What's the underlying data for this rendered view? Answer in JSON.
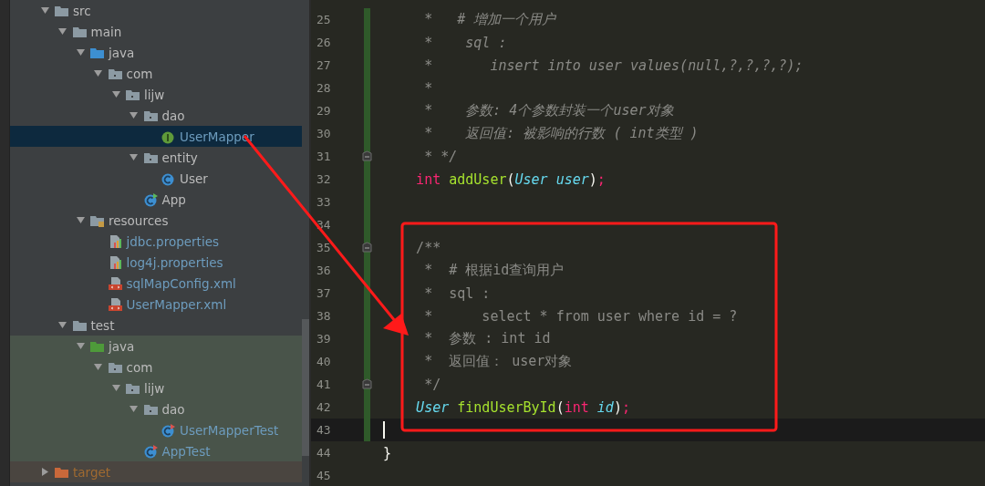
{
  "project_tree": {
    "items": [
      {
        "label": "src",
        "kind": "folder",
        "expanded": true,
        "selected": false,
        "test_scope": false,
        "children": [
          {
            "label": "main",
            "kind": "folder",
            "expanded": true,
            "selected": false,
            "test_scope": false,
            "children": [
              {
                "label": "java",
                "kind": "source-folder",
                "expanded": true,
                "selected": false,
                "test_scope": false,
                "children": [
                  {
                    "label": "com",
                    "kind": "package",
                    "expanded": true,
                    "selected": false,
                    "test_scope": false,
                    "children": [
                      {
                        "label": "lijw",
                        "kind": "package",
                        "expanded": true,
                        "selected": false,
                        "test_scope": false,
                        "children": [
                          {
                            "label": "dao",
                            "kind": "package",
                            "expanded": true,
                            "selected": false,
                            "test_scope": false,
                            "children": [
                              {
                                "label": "UserMapper",
                                "kind": "interface",
                                "selected": true,
                                "test_scope": false
                              }
                            ]
                          },
                          {
                            "label": "entity",
                            "kind": "package",
                            "expanded": true,
                            "selected": false,
                            "test_scope": false,
                            "children": [
                              {
                                "label": "User",
                                "kind": "class",
                                "selected": false,
                                "test_scope": false
                              }
                            ]
                          },
                          {
                            "label": "App",
                            "kind": "main-class",
                            "selected": false,
                            "test_scope": false
                          }
                        ]
                      }
                    ]
                  }
                ]
              },
              {
                "label": "resources",
                "kind": "resources-folder",
                "expanded": true,
                "selected": false,
                "test_scope": false,
                "children": [
                  {
                    "label": "jdbc.properties",
                    "kind": "properties",
                    "selected": false,
                    "test_scope": false
                  },
                  {
                    "label": "log4j.properties",
                    "kind": "properties",
                    "selected": false,
                    "test_scope": false
                  },
                  {
                    "label": "sqlMapConfig.xml",
                    "kind": "xml",
                    "selected": false,
                    "test_scope": false
                  },
                  {
                    "label": "UserMapper.xml",
                    "kind": "xml",
                    "selected": false,
                    "test_scope": false
                  }
                ]
              }
            ]
          },
          {
            "label": "test",
            "kind": "folder",
            "expanded": true,
            "selected": false,
            "test_scope": false,
            "children": [
              {
                "label": "java",
                "kind": "test-folder",
                "expanded": true,
                "selected": false,
                "test_scope": true,
                "children": [
                  {
                    "label": "com",
                    "kind": "package",
                    "expanded": true,
                    "selected": false,
                    "test_scope": true,
                    "children": [
                      {
                        "label": "lijw",
                        "kind": "package",
                        "expanded": true,
                        "selected": false,
                        "test_scope": true,
                        "children": [
                          {
                            "label": "dao",
                            "kind": "package",
                            "expanded": true,
                            "selected": false,
                            "test_scope": true,
                            "children": [
                              {
                                "label": "UserMapperTest",
                                "kind": "test-class",
                                "selected": false,
                                "test_scope": true
                              }
                            ]
                          },
                          {
                            "label": "AppTest",
                            "kind": "test-class",
                            "selected": false,
                            "test_scope": true
                          }
                        ]
                      }
                    ]
                  }
                ]
              }
            ]
          }
        ]
      },
      {
        "label": "target",
        "kind": "excluded-folder",
        "expanded": false,
        "selected": false,
        "test_scope": false
      }
    ]
  },
  "editor": {
    "lines": [
      {
        "number": "25",
        "current": false,
        "fold_marker": false,
        "tokens": [
          {
            "text": "     *   # 增加一个用户",
            "kind": "comment"
          }
        ]
      },
      {
        "number": "26",
        "current": false,
        "fold_marker": false,
        "tokens": [
          {
            "text": "     *    sql :",
            "kind": "comment"
          }
        ]
      },
      {
        "number": "27",
        "current": false,
        "fold_marker": false,
        "tokens": [
          {
            "text": "     *       insert into user values(null,?,?,?,?);",
            "kind": "comment"
          }
        ]
      },
      {
        "number": "28",
        "current": false,
        "fold_marker": false,
        "tokens": [
          {
            "text": "     *",
            "kind": "comment"
          }
        ]
      },
      {
        "number": "29",
        "current": false,
        "fold_marker": false,
        "tokens": [
          {
            "text": "     *    参数: 4个参数封装一个user对象",
            "kind": "comment"
          }
        ]
      },
      {
        "number": "30",
        "current": false,
        "fold_marker": false,
        "tokens": [
          {
            "text": "     *    返回值: 被影响的行数 ( int类型 )",
            "kind": "comment"
          }
        ]
      },
      {
        "number": "31",
        "current": false,
        "fold_marker": true,
        "tokens": [
          {
            "text": "     * */",
            "kind": "comment"
          }
        ]
      },
      {
        "number": "32",
        "current": false,
        "fold_marker": false,
        "tokens": [
          {
            "text": "    int",
            "kind": "keyword"
          },
          {
            "text": " addUser",
            "kind": "function"
          },
          {
            "text": "(",
            "kind": "plain"
          },
          {
            "text": "User",
            "kind": "type"
          },
          {
            "text": " user",
            "kind": "param"
          },
          {
            "text": ")",
            "kind": "plain"
          },
          {
            "text": ";",
            "kind": "keyword"
          }
        ]
      },
      {
        "number": "33",
        "current": false,
        "fold_marker": false
      },
      {
        "number": "34",
        "current": false,
        "fold_marker": false
      },
      {
        "number": "35",
        "current": false,
        "fold_marker": true,
        "tokens": [
          {
            "text": "    /**",
            "kind": "doc"
          }
        ]
      },
      {
        "number": "36",
        "current": false,
        "fold_marker": false,
        "tokens": [
          {
            "text": "     *  # 根据id查询用户",
            "kind": "doc"
          }
        ]
      },
      {
        "number": "37",
        "current": false,
        "fold_marker": false,
        "tokens": [
          {
            "text": "     *  sql :",
            "kind": "doc"
          }
        ]
      },
      {
        "number": "38",
        "current": false,
        "fold_marker": false,
        "tokens": [
          {
            "text": "     *      select * from user where id = ?",
            "kind": "doc"
          }
        ]
      },
      {
        "number": "39",
        "current": false,
        "fold_marker": false,
        "tokens": [
          {
            "text": "     *  参数 : int id",
            "kind": "doc"
          }
        ]
      },
      {
        "number": "40",
        "current": false,
        "fold_marker": false,
        "tokens": [
          {
            "text": "     *  返回值： user对象",
            "kind": "doc"
          }
        ]
      },
      {
        "number": "41",
        "current": false,
        "fold_marker": true,
        "tokens": [
          {
            "text": "     */",
            "kind": "doc"
          }
        ]
      },
      {
        "number": "42",
        "current": false,
        "fold_marker": false,
        "tokens": [
          {
            "text": "    User",
            "kind": "type"
          },
          {
            "text": " findUserById",
            "kind": "function"
          },
          {
            "text": "(",
            "kind": "plain"
          },
          {
            "text": "int",
            "kind": "keyword"
          },
          {
            "text": " id",
            "kind": "param"
          },
          {
            "text": ")",
            "kind": "plain"
          },
          {
            "text": ";",
            "kind": "keyword"
          }
        ]
      },
      {
        "number": "43",
        "current": true,
        "fold_marker": false
      },
      {
        "number": "44",
        "current": false,
        "fold_marker": false,
        "tokens": [
          {
            "text": "}",
            "kind": "plain"
          }
        ]
      },
      {
        "number": "45",
        "current": false,
        "fold_marker": false
      }
    ]
  }
}
